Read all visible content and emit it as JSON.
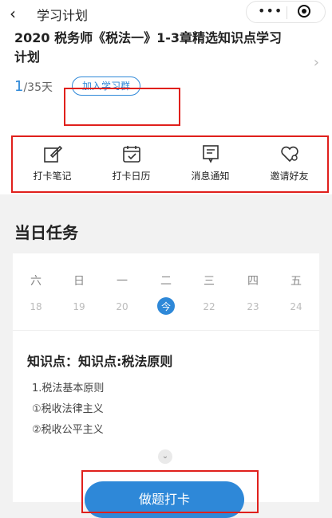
{
  "header": {
    "title": "学习计划"
  },
  "plan": {
    "title": "2020 税务师《税法一》1-3章精选知识点学习计划",
    "current_day": "1",
    "total_days": "/35天",
    "join_group_label": "加入学习群"
  },
  "actions": [
    {
      "label": "打卡笔记",
      "icon": "edit-note-icon"
    },
    {
      "label": "打卡日历",
      "icon": "calendar-check-icon"
    },
    {
      "label": "消息通知",
      "icon": "message-icon"
    },
    {
      "label": "邀请好友",
      "icon": "heart-invite-icon"
    }
  ],
  "daily": {
    "title": "当日任务",
    "weekdays": [
      "六",
      "日",
      "一",
      "二",
      "三",
      "四",
      "五"
    ],
    "dates": [
      "18",
      "19",
      "20",
      "今",
      "22",
      "23",
      "24"
    ],
    "today_index": 3
  },
  "knowledge": {
    "title": "知识点：知识点:税法原则",
    "lines": [
      "1.税法基本原则",
      "①税收法律主义",
      "②税收公平主义"
    ]
  },
  "do_button": "做题打卡",
  "colors": {
    "accent": "#2e88d8",
    "highlight": "#e0201c"
  }
}
